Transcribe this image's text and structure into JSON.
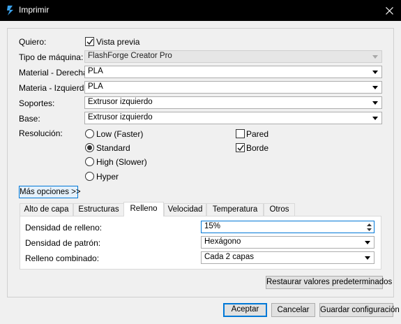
{
  "window": {
    "title": "Imprimir"
  },
  "form": {
    "quiero_label": "Quiero:",
    "vista_previa_label": "Vista previa",
    "vista_previa_checked": true,
    "tipo_maquina_label": "Tipo de máquina:",
    "tipo_maquina_value": "FlashForge Creator Pro",
    "material_derecha_label": "Material - Derecha:",
    "material_derecha_value": "PLA",
    "materia_izquierda_label": "Materia - Izquierda:",
    "materia_izquierda_value": "PLA",
    "soportes_label": "Soportes:",
    "soportes_value": "Extrusor izquierdo",
    "base_label": "Base:",
    "base_value": "Extrusor izquierdo",
    "resolucion_label": "Resolución:",
    "resolutions": [
      {
        "label": "Low (Faster)",
        "selected": false
      },
      {
        "label": "Standard",
        "selected": true
      },
      {
        "label": "High (Slower)",
        "selected": false
      },
      {
        "label": "Hyper",
        "selected": false
      }
    ],
    "pared_label": "Pared",
    "pared_checked": false,
    "borde_label": "Borde",
    "borde_checked": true,
    "mas_opciones_label": "Más opciones >>"
  },
  "tabs": [
    {
      "label": "Alto de capa",
      "active": false
    },
    {
      "label": "Estructuras",
      "active": false
    },
    {
      "label": "Relleno",
      "active": true
    },
    {
      "label": "Velocidad",
      "active": false
    },
    {
      "label": "Temperatura",
      "active": false
    },
    {
      "label": "Otros",
      "active": false
    }
  ],
  "relleno": {
    "densidad_relleno_label": "Densidad de relleno:",
    "densidad_relleno_value": "15%",
    "densidad_patron_label": "Densidad de patrón:",
    "densidad_patron_value": "Hexágono",
    "relleno_combinado_label": "Relleno combinado:",
    "relleno_combinado_value": "Cada 2 capas"
  },
  "buttons": {
    "restaurar": "Restaurar valores predeterminados",
    "aceptar": "Aceptar",
    "cancelar": "Cancelar",
    "guardar": "Guardar configuración"
  },
  "colors": {
    "titlebar": "#000000",
    "accent": "#0078d7",
    "dialog_bg": "#f0f0f0"
  }
}
